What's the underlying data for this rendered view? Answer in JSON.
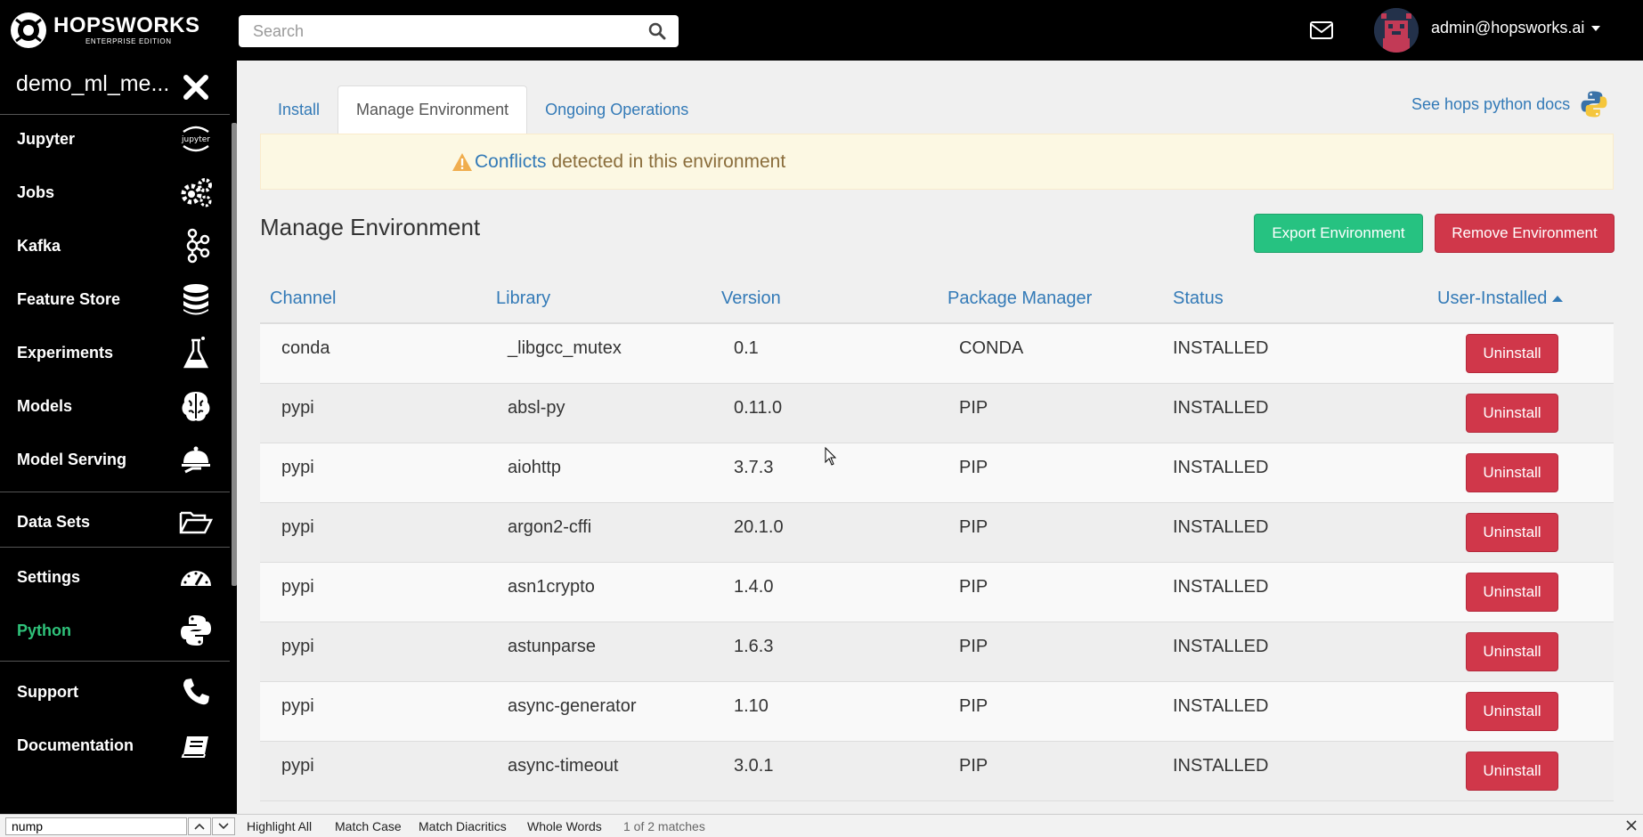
{
  "brand": {
    "title": "HOPSWORKS",
    "subtitle": "ENTERPRISE EDITION"
  },
  "search": {
    "placeholder": "Search"
  },
  "user": {
    "email": "admin@hopsworks.ai"
  },
  "sidebar": {
    "project": "demo_ml_me...",
    "items": [
      {
        "label": "Jupyter",
        "icon": "jupyter-icon"
      },
      {
        "label": "Jobs",
        "icon": "gears-icon"
      },
      {
        "label": "Kafka",
        "icon": "kafka-icon"
      },
      {
        "label": "Feature Store",
        "icon": "database-icon"
      },
      {
        "label": "Experiments",
        "icon": "flask-icon"
      },
      {
        "label": "Models",
        "icon": "brain-icon"
      },
      {
        "label": "Model Serving",
        "icon": "serving-icon"
      },
      {
        "label": "Data Sets",
        "icon": "folder-open-icon"
      },
      {
        "label": "Settings",
        "icon": "dashboard-icon"
      },
      {
        "label": "Python",
        "icon": "python-icon",
        "active": true
      },
      {
        "label": "Support",
        "icon": "phone-icon"
      },
      {
        "label": "Documentation",
        "icon": "book-icon"
      }
    ]
  },
  "tabs": [
    "Install",
    "Manage Environment",
    "Ongoing Operations"
  ],
  "docs_link": "See hops python docs",
  "alert": {
    "link": "Conflicts",
    "text": "detected in this environment"
  },
  "heading": "Manage Environment",
  "buttons": {
    "export": "Export Environment",
    "remove": "Remove Environment"
  },
  "table": {
    "columns": [
      "Channel",
      "Library",
      "Version",
      "Package Manager",
      "Status",
      "User-Installed"
    ],
    "action_label": "Uninstall",
    "rows": [
      [
        "conda",
        "_libgcc_mutex",
        "0.1",
        "CONDA",
        "INSTALLED"
      ],
      [
        "pypi",
        "absl-py",
        "0.11.0",
        "PIP",
        "INSTALLED"
      ],
      [
        "pypi",
        "aiohttp",
        "3.7.3",
        "PIP",
        "INSTALLED"
      ],
      [
        "pypi",
        "argon2-cffi",
        "20.1.0",
        "PIP",
        "INSTALLED"
      ],
      [
        "pypi",
        "asn1crypto",
        "1.4.0",
        "PIP",
        "INSTALLED"
      ],
      [
        "pypi",
        "astunparse",
        "1.6.3",
        "PIP",
        "INSTALLED"
      ],
      [
        "pypi",
        "async-generator",
        "1.10",
        "PIP",
        "INSTALLED"
      ],
      [
        "pypi",
        "async-timeout",
        "3.0.1",
        "PIP",
        "INSTALLED"
      ]
    ]
  },
  "findbar": {
    "query": "nump",
    "highlight_all": "Highlight All",
    "match_case": "Match Case",
    "match_diacritics": "Match Diacritics",
    "whole_words": "Whole Words",
    "matches": "1 of 2 matches"
  },
  "colors": {
    "accent_green": "#26c281",
    "danger_red": "#d0374a",
    "link_blue": "#337ab7",
    "active_nav": "#2fc27a"
  }
}
